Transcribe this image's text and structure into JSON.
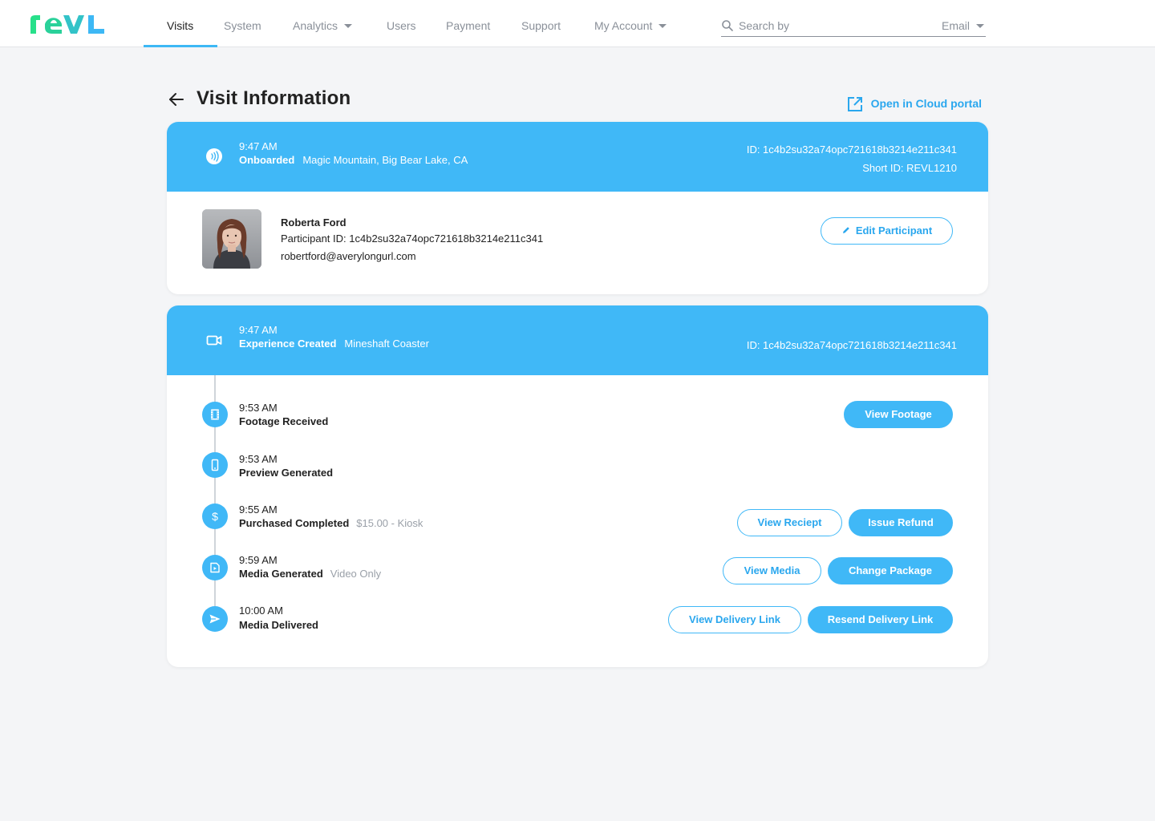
{
  "nav": {
    "items": [
      {
        "label": "Visits"
      },
      {
        "label": "System"
      },
      {
        "label": "Analytics"
      },
      {
        "label": "Users"
      },
      {
        "label": "Payment"
      },
      {
        "label": "Support"
      },
      {
        "label": "My Account"
      }
    ],
    "active": "Visits",
    "search": {
      "placeholder": "Search by",
      "value": "",
      "filter": "Email"
    }
  },
  "colors": {
    "accent": "#40b8f7",
    "accent_text": "#2aa7ee",
    "logo_green": "#27e08a",
    "logo_blue": "#3db8f5"
  },
  "page": {
    "title": "Visit Information",
    "cloud_link": "Open in Cloud portal"
  },
  "onboard": {
    "time": "9:47 AM",
    "status": "Onboarded",
    "location": "Magic Mountain, Big Bear Lake, CA",
    "id": "ID: 1c4b2su32a74opc721618b3214e211c341",
    "short_id": "Short ID: REVL1210",
    "icon": "nfc-icon"
  },
  "participant": {
    "name": "Roberta Ford",
    "participant_id": "Participant ID: 1c4b2su32a74opc721618b3214e211c341",
    "email": "robertford@averylongurl.com",
    "edit_label": "Edit Participant"
  },
  "experience": {
    "time": "9:47 AM",
    "status": "Experience Created",
    "name": "Mineshaft Coaster",
    "id": "ID: 1c4b2su32a74opc721618b3214e211c341",
    "icon": "video-camera-icon"
  },
  "timeline": [
    {
      "time": "9:53 AM",
      "label": "Footage Received",
      "detail": "",
      "icon": "film-icon",
      "buttons": [
        {
          "label": "View Footage",
          "style": "solid"
        }
      ]
    },
    {
      "time": "9:53 AM",
      "label": "Preview Generated",
      "detail": "",
      "icon": "phone-icon",
      "buttons": []
    },
    {
      "time": "9:55 AM",
      "label": "Purchased Completed",
      "detail": "$15.00 - Kiosk",
      "icon": "dollar-icon",
      "buttons": [
        {
          "label": "View Reciept",
          "style": "outline"
        },
        {
          "label": "Issue Refund",
          "style": "solid"
        }
      ]
    },
    {
      "time": "9:59 AM",
      "label": "Media Generated",
      "detail": "Video Only",
      "icon": "media-icon",
      "buttons": [
        {
          "label": "View Media",
          "style": "outline"
        },
        {
          "label": "Change Package",
          "style": "solid"
        }
      ]
    },
    {
      "time": "10:00 AM",
      "label": "Media Delivered",
      "detail": "",
      "icon": "send-icon",
      "buttons": [
        {
          "label": "View Delivery Link",
          "style": "outline"
        },
        {
          "label": "Resend Delivery Link",
          "style": "solid"
        }
      ]
    }
  ]
}
